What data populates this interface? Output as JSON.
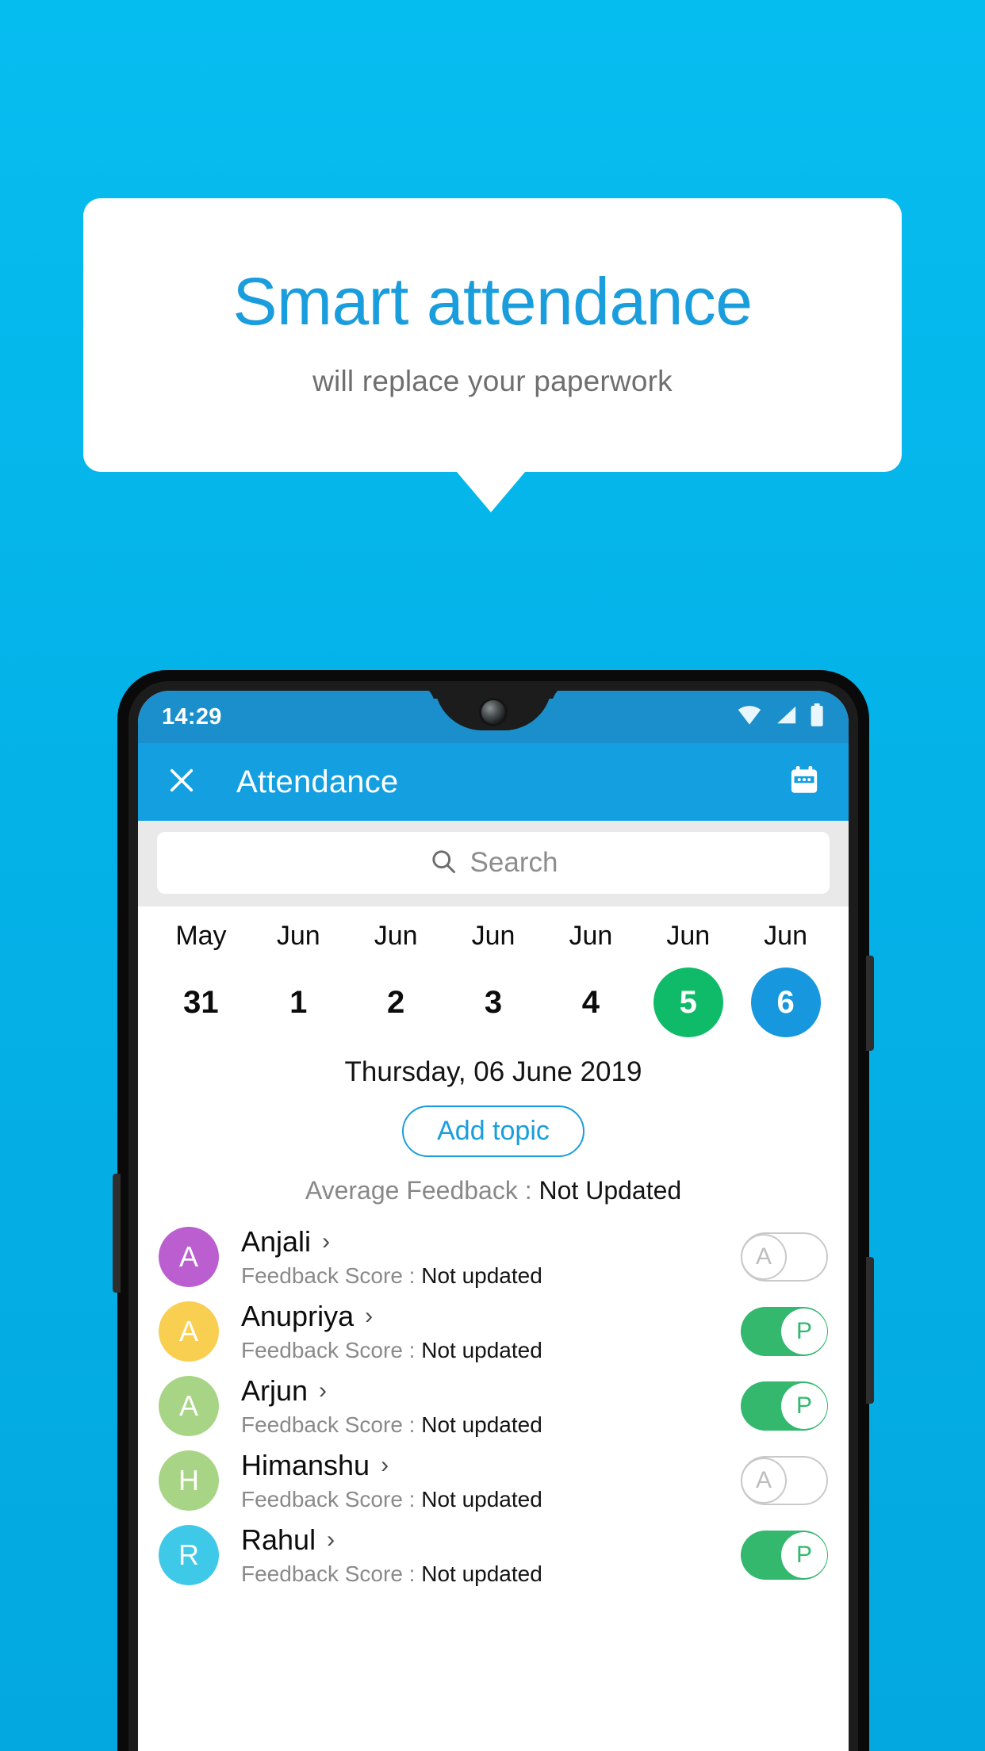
{
  "promo": {
    "title": "Smart attendance",
    "subtitle": "will replace your paperwork",
    "bg_color": "#06bdf0",
    "accent_color": "#1a9ddc"
  },
  "phone": {
    "statusbar": {
      "time": "14:29",
      "icons": [
        "wifi-icon",
        "signal-icon",
        "battery-icon"
      ]
    },
    "appbar": {
      "close_icon": "close-icon",
      "title": "Attendance",
      "calendar_icon": "calendar-icon",
      "bg_color": "#149fe0"
    },
    "search": {
      "icon": "search-icon",
      "placeholder": "Search",
      "value": ""
    },
    "date_strip": [
      {
        "month": "May",
        "day": "31",
        "state": "normal"
      },
      {
        "month": "Jun",
        "day": "1",
        "state": "normal"
      },
      {
        "month": "Jun",
        "day": "2",
        "state": "normal"
      },
      {
        "month": "Jun",
        "day": "3",
        "state": "normal"
      },
      {
        "month": "Jun",
        "day": "4",
        "state": "normal"
      },
      {
        "month": "Jun",
        "day": "5",
        "state": "green"
      },
      {
        "month": "Jun",
        "day": "6",
        "state": "blue"
      }
    ],
    "selected_date_label": "Thursday, 06 June 2019",
    "add_topic_label": "Add topic",
    "average_feedback": {
      "label": "Average Feedback : ",
      "value": "Not Updated"
    },
    "score_label": "Feedback Score : ",
    "students": [
      {
        "name": "Anjali",
        "initial": "A",
        "avatar_color": "#bb5fd0",
        "score": "Not updated",
        "attendance": "A",
        "present": false
      },
      {
        "name": "Anupriya",
        "initial": "A",
        "avatar_color": "#f9cf52",
        "score": "Not updated",
        "attendance": "P",
        "present": true
      },
      {
        "name": "Arjun",
        "initial": "A",
        "avatar_color": "#a8d585",
        "score": "Not updated",
        "attendance": "P",
        "present": true
      },
      {
        "name": "Himanshu",
        "initial": "H",
        "avatar_color": "#a8d585",
        "score": "Not updated",
        "attendance": "A",
        "present": false
      },
      {
        "name": "Rahul",
        "initial": "R",
        "avatar_color": "#3ec9e8",
        "score": "Not updated",
        "attendance": "P",
        "present": true
      }
    ],
    "chevron": "›",
    "colors": {
      "present_green": "#33b86e",
      "selected_blue": "#1797dd",
      "today_green": "#0fbb69"
    }
  }
}
